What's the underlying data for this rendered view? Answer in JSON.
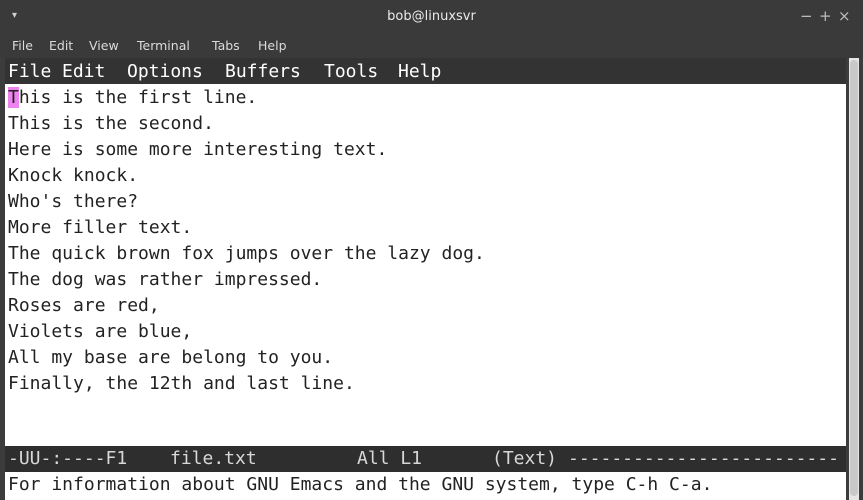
{
  "window": {
    "title": "bob@linuxsvr",
    "menu_glyph": "▾",
    "controls": [
      "−",
      "+",
      "×"
    ]
  },
  "terminal_menu": [
    "File",
    "Edit",
    "View",
    "Terminal",
    "Tabs",
    "Help"
  ],
  "emacs_menu": [
    "File",
    "Edit",
    "Options",
    "Buffers",
    "Tools",
    "Help"
  ],
  "buffer": {
    "cursor_char": "T",
    "first_line_rest": "his is the first line.",
    "lines": [
      "This is the second.",
      "Here is some more interesting text.",
      "Knock knock.",
      "Who's there?",
      "More filler text.",
      "The quick brown fox jumps over the lazy dog.",
      "The dog was rather impressed.",
      "Roses are red,",
      "Violets are blue,",
      "All my base are belong to you.",
      "Finally, the 12th and last line."
    ]
  },
  "modeline": {
    "status": "-UU-:----F1",
    "filename": "file.txt",
    "position": "All L1",
    "mode": "(Text)",
    "dashes": "-------------------------"
  },
  "echo_area": "For information about GNU Emacs and the GNU system, type C-h C-a.",
  "colors": {
    "cursor": "#ee82ee",
    "titlebar": "#3a3a3a",
    "emacs_menu_bg": "#333333"
  }
}
